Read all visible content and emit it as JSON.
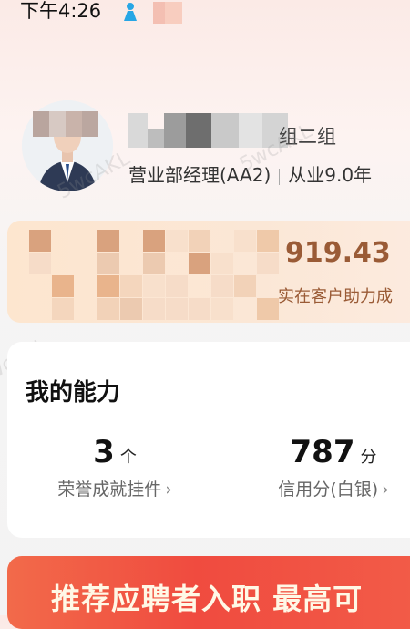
{
  "status_bar": {
    "time": "下午4:26"
  },
  "profile": {
    "team": "组二组",
    "role": "营业部经理(AA2)",
    "experience": "从业9.0年"
  },
  "stats_card": {
    "amount": "919.43",
    "amount_label": "实在客户助力成"
  },
  "ability": {
    "title": "我的能力",
    "items": [
      {
        "value": "3",
        "unit": "个",
        "label": "荣誉成就挂件"
      },
      {
        "value": "787",
        "unit": "分",
        "label": "信用分(白银)"
      }
    ]
  },
  "banner": {
    "text": "推荐应聘者入职 最高可"
  },
  "watermark": "5wcAKL",
  "colors": {
    "accent": "#9a5b36",
    "banner": "#f04b3f"
  }
}
